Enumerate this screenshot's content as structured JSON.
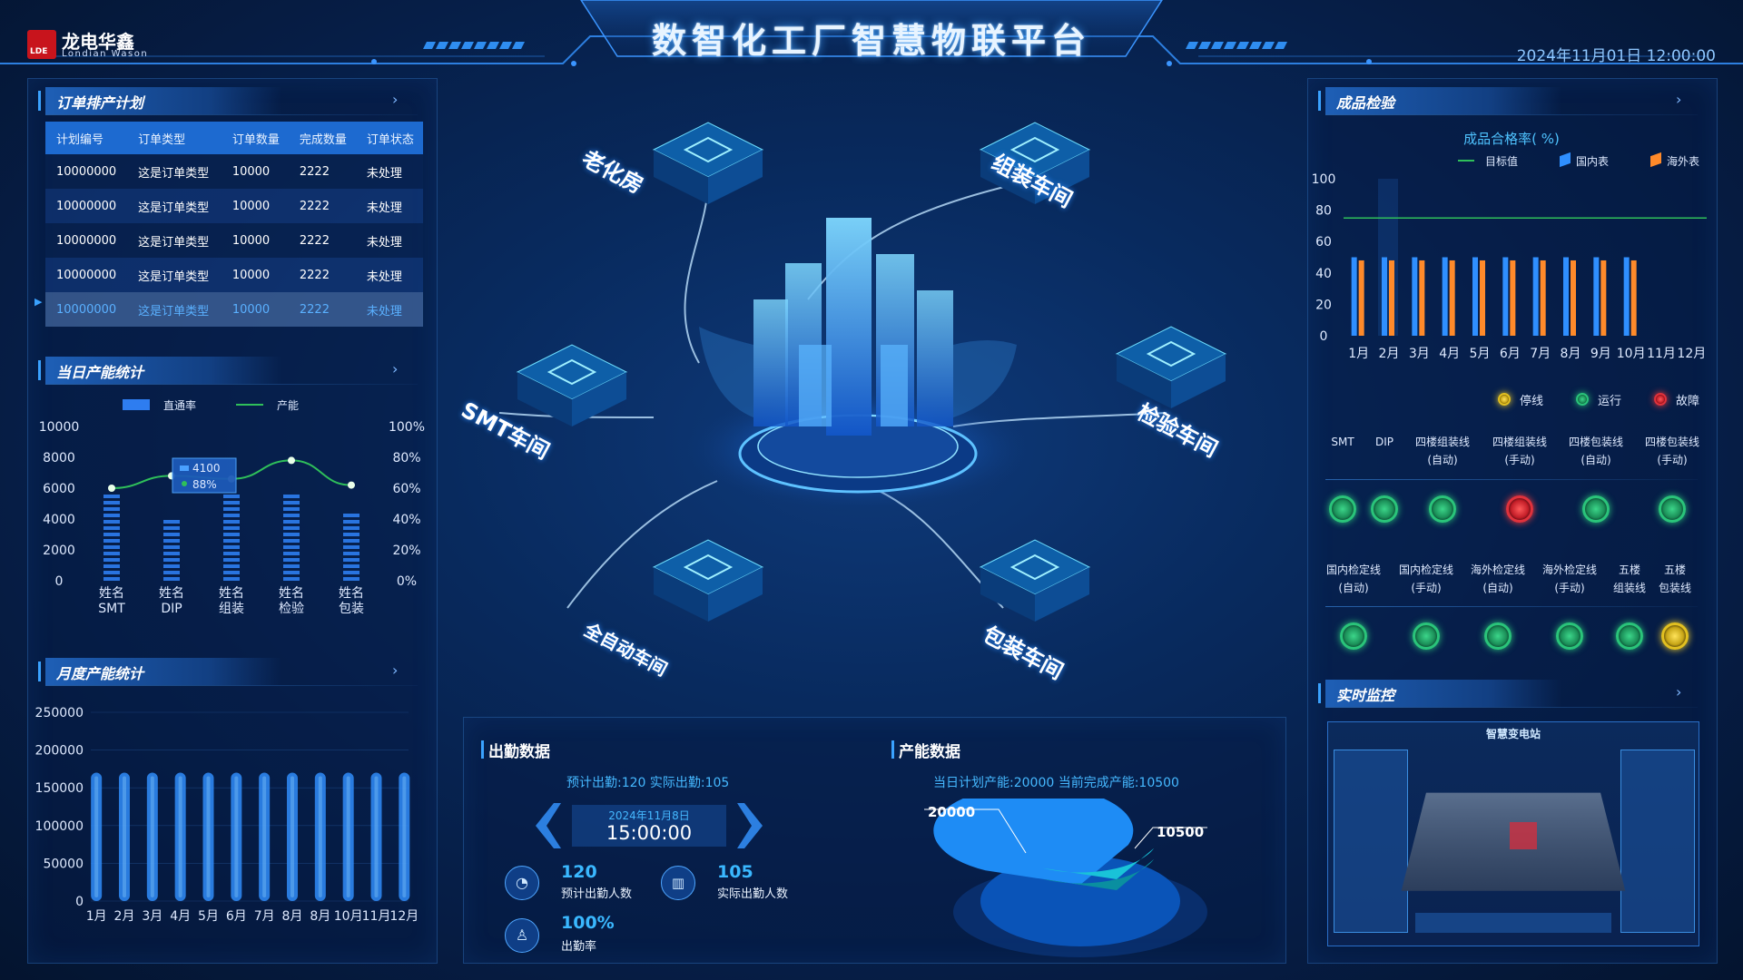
{
  "header": {
    "title": "数智化工厂智慧物联平台",
    "logo_cn": "龙电华鑫",
    "logo_en": "Londian Wason",
    "logo_mark": "LDE",
    "datetime": "2024年11月01日   12:00:00"
  },
  "orders": {
    "title": "订单排产计划",
    "columns": [
      "计划编号",
      "订单类型",
      "订单数量",
      "完成数量",
      "订单状态"
    ],
    "rows": [
      [
        "10000000",
        "这是订单类型",
        "10000",
        "2222",
        "未处理"
      ],
      [
        "10000000",
        "这是订单类型",
        "10000",
        "2222",
        "未处理"
      ],
      [
        "10000000",
        "这是订单类型",
        "10000",
        "2222",
        "未处理"
      ],
      [
        "10000000",
        "这是订单类型",
        "10000",
        "2222",
        "未处理"
      ],
      [
        "10000000",
        "这是订单类型",
        "10000",
        "2222",
        "未处理"
      ]
    ],
    "selected_row": 4
  },
  "daily_capacity": {
    "title": "当日产能统计",
    "tooltip_value": "4100",
    "tooltip_rate": "88%"
  },
  "monthly_capacity": {
    "title": "月度产能统计"
  },
  "chart_data": [
    {
      "type": "bar",
      "title": "当日产能统计",
      "categories": [
        "姓名 SMT",
        "姓名 DIP",
        "姓名 组装",
        "姓名 检验",
        "姓名 包装"
      ],
      "series": [
        {
          "name": "直通率",
          "type": "bar",
          "values": [
            6000,
            4200,
            5900,
            6000,
            4800
          ]
        },
        {
          "name": "产能",
          "type": "line",
          "axis": "right",
          "values": [
            60,
            68,
            66,
            78,
            62
          ]
        }
      ],
      "ylim": [
        0,
        10000
      ],
      "y_ticks": [
        "0",
        "2000",
        "4000",
        "6000",
        "8000",
        "10000"
      ],
      "y2lim": [
        0,
        100
      ],
      "y2_ticks": [
        "0%",
        "20%",
        "40%",
        "60%",
        "80%",
        "100%"
      ],
      "legend": "top"
    },
    {
      "type": "bar",
      "title": "月度产能统计",
      "categories": [
        "1月",
        "2月",
        "3月",
        "4月",
        "5月",
        "6月",
        "7月",
        "8月",
        "8月",
        "10月",
        "11月",
        "12月"
      ],
      "values": [
        170000,
        170000,
        170000,
        170000,
        170000,
        170000,
        170000,
        170000,
        170000,
        170000,
        170000,
        170000
      ],
      "ylim": [
        0,
        250000
      ],
      "y_ticks": [
        "0",
        "50000",
        "100000",
        "150000",
        "200000",
        "250000"
      ]
    },
    {
      "type": "bar",
      "title": "成品合格率( %)",
      "categories": [
        "1月",
        "2月",
        "3月",
        "4月",
        "5月",
        "6月",
        "7月",
        "8月",
        "9月",
        "10月",
        "11月",
        "12月"
      ],
      "series": [
        {
          "name": "国内表",
          "values": [
            50,
            50,
            50,
            50,
            50,
            50,
            50,
            50,
            50,
            50,
            0,
            0
          ]
        },
        {
          "name": "海外表",
          "values": [
            48,
            48,
            48,
            48,
            48,
            48,
            48,
            48,
            48,
            48,
            0,
            0
          ]
        },
        {
          "name": "目标值",
          "type": "line",
          "values": [
            75
          ]
        }
      ],
      "ylim": [
        0,
        100
      ],
      "y_ticks": [
        "0",
        "20",
        "40",
        "60",
        "80",
        "100"
      ],
      "legend": "top-right"
    },
    {
      "type": "pie",
      "title": "产能数据",
      "labels": [
        "当日计划产能",
        "当前完成产能"
      ],
      "values": [
        20000,
        10500
      ]
    }
  ],
  "inspection": {
    "title": "成品检验",
    "chart_title": "成品合格率( %)",
    "legend": [
      "目标值",
      "国内表",
      "海外表"
    ]
  },
  "line_status": {
    "legend": [
      "停线",
      "运行",
      "故障"
    ],
    "row1": [
      {
        "label": "SMT",
        "status": "run"
      },
      {
        "label": "DIP",
        "status": "run"
      },
      {
        "label": "四楼组装线\n(自动)",
        "status": "run"
      },
      {
        "label": "四楼组装线\n(手动)",
        "status": "fault"
      },
      {
        "label": "四楼包装线\n(自动)",
        "status": "run"
      },
      {
        "label": "四楼包装线\n(手动)",
        "status": "run"
      }
    ],
    "row2": [
      {
        "label": "国内检定线\n(自动)",
        "status": "run"
      },
      {
        "label": "国内检定线\n(手动)",
        "status": "run"
      },
      {
        "label": "海外检定线\n(自动)",
        "status": "run"
      },
      {
        "label": "海外检定线\n(手动)",
        "status": "run"
      },
      {
        "label": "五楼\n组装线",
        "status": "run"
      },
      {
        "label": "五楼\n包装线",
        "status": "stop"
      }
    ]
  },
  "monitor": {
    "title": "实时监控",
    "screen_title": "智慧变电站"
  },
  "workshops": [
    "老化房",
    "组装车间",
    "SMT车间",
    "检验车间",
    "全自动车间",
    "包装车间"
  ],
  "attendance": {
    "title": "出勤数据",
    "summary": "预计出勤:120   实际出勤:105",
    "date": "2024年11月8日",
    "time": "15:00:00",
    "expected_value": "120",
    "expected_label": "预计出勤人数",
    "actual_value": "105",
    "actual_label": "实际出勤人数",
    "rate_value": "100%",
    "rate_label": "出勤率"
  },
  "capacity_data": {
    "title": "产能数据",
    "summary": "当日计划产能:20000   当前完成产能:10500",
    "plan_label": "20000",
    "done_label": "10500"
  },
  "colors": {
    "accent": "#3aa2ff",
    "domestic": "#2f8fff",
    "overseas": "#ff8a2a",
    "target": "#2fbf5a",
    "run": "#2ac47a",
    "fault": "#e0323c",
    "stop": "#e2c020"
  }
}
